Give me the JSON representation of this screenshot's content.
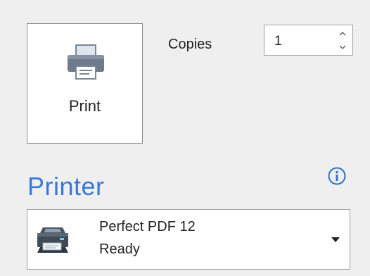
{
  "print_button": {
    "label": "Print",
    "icon": "printer-icon"
  },
  "copies": {
    "label": "Copies",
    "value": "1",
    "up_icon": "chevron-up-icon",
    "down_icon": "chevron-down-icon"
  },
  "printer": {
    "heading": "Printer",
    "info_icon": "info-icon",
    "selected_name": "Perfect PDF 12",
    "selected_status": "Ready",
    "device_icon": "printer-device-icon",
    "dropdown_icon": "caret-down-icon"
  },
  "colors": {
    "background": "#efefef",
    "heading_accent": "#3a78d6",
    "info_accent": "#2e72c9",
    "printer_icon_gray": "#6d7a8a"
  }
}
